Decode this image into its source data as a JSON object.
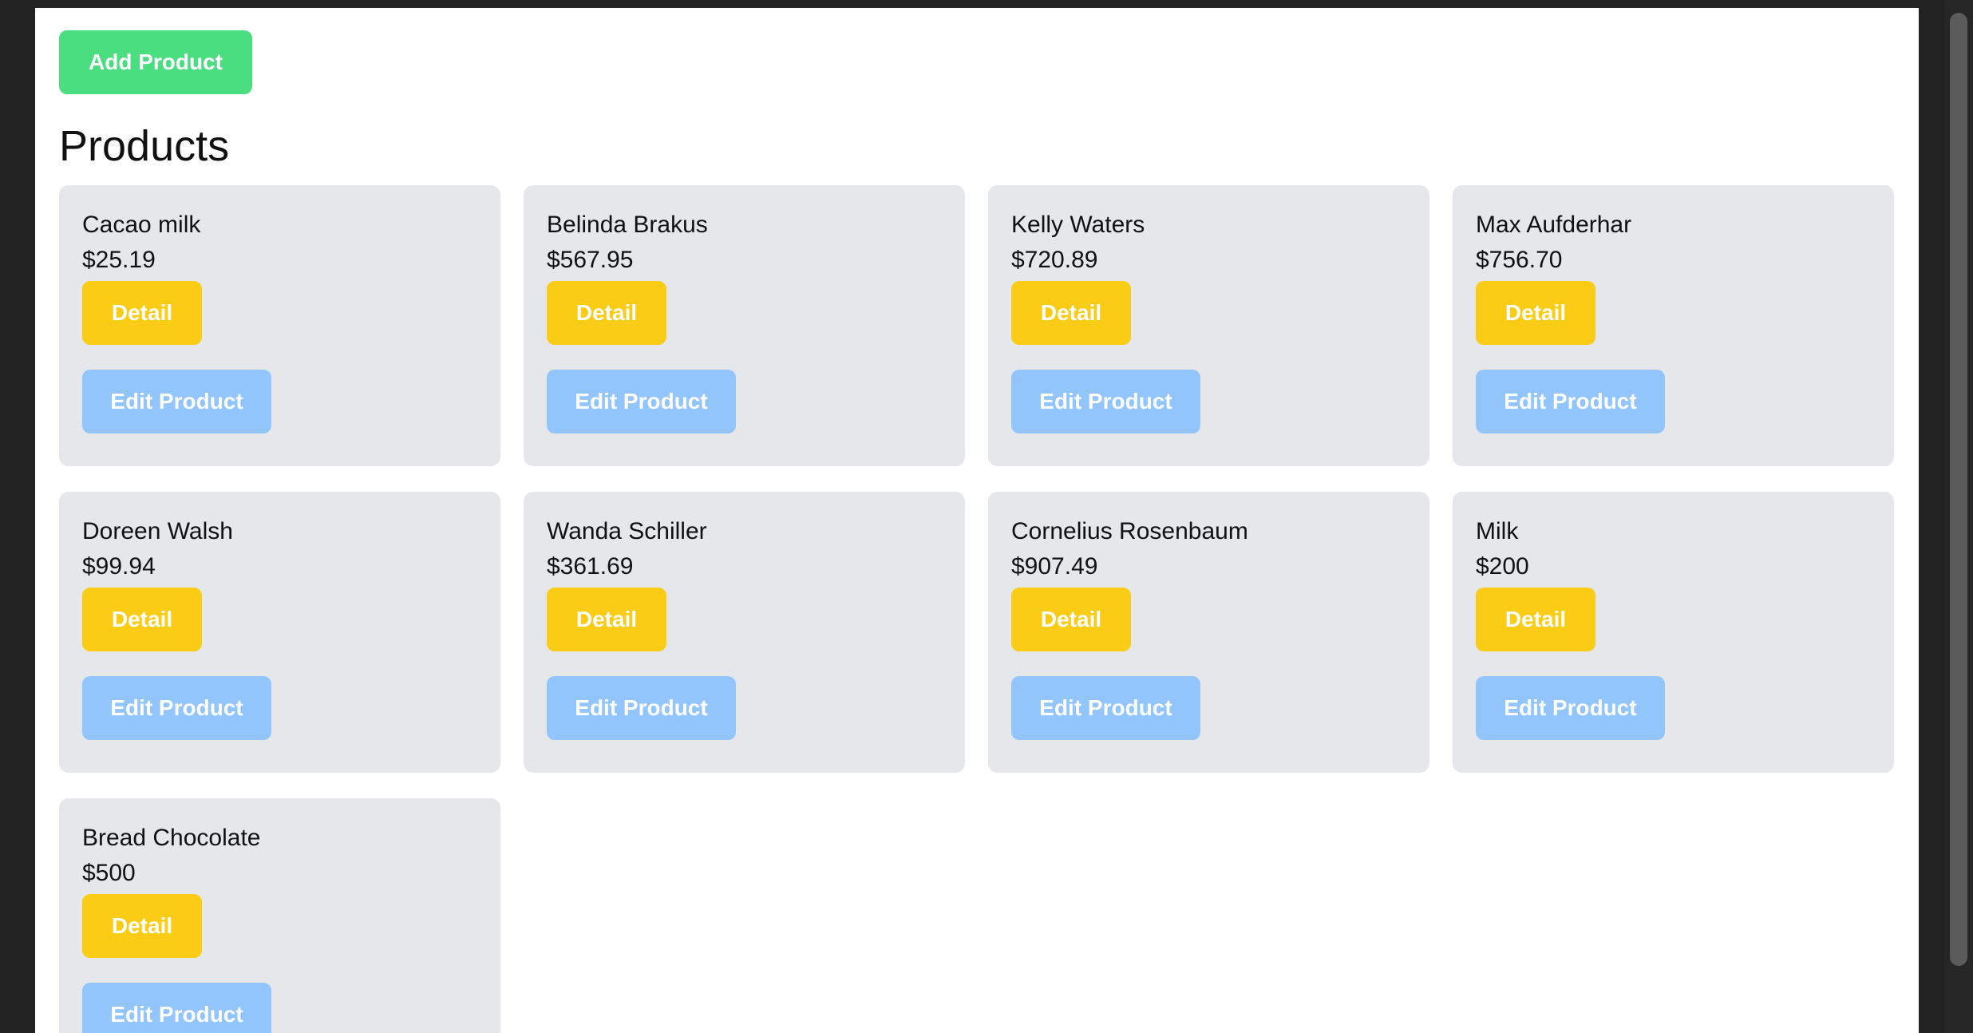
{
  "toolbar": {
    "add_label": "Add Product"
  },
  "page": {
    "title": "Products"
  },
  "colors": {
    "add": "#4ade80",
    "detail": "#facc15",
    "edit": "#93c5fd",
    "card": "#e5e7eb"
  },
  "products": [
    {
      "name": "Cacao milk",
      "price": "$25.19",
      "detail_label": "Detail",
      "edit_label": "Edit Product"
    },
    {
      "name": "Belinda Brakus",
      "price": "$567.95",
      "detail_label": "Detail",
      "edit_label": "Edit Product"
    },
    {
      "name": "Kelly Waters",
      "price": "$720.89",
      "detail_label": "Detail",
      "edit_label": "Edit Product"
    },
    {
      "name": "Max Aufderhar",
      "price": "$756.70",
      "detail_label": "Detail",
      "edit_label": "Edit Product"
    },
    {
      "name": "Doreen Walsh",
      "price": "$99.94",
      "detail_label": "Detail",
      "edit_label": "Edit Product"
    },
    {
      "name": "Wanda Schiller",
      "price": "$361.69",
      "detail_label": "Detail",
      "edit_label": "Edit Product"
    },
    {
      "name": "Cornelius Rosenbaum",
      "price": "$907.49",
      "detail_label": "Detail",
      "edit_label": "Edit Product"
    },
    {
      "name": "Milk",
      "price": "$200",
      "detail_label": "Detail",
      "edit_label": "Edit Product"
    },
    {
      "name": "Bread Chocolate",
      "price": "$500",
      "detail_label": "Detail",
      "edit_label": "Edit Product"
    }
  ]
}
